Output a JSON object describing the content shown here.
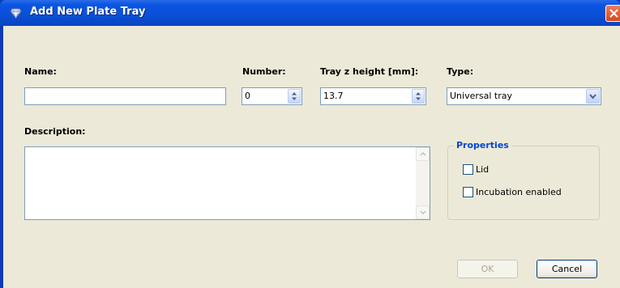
{
  "window": {
    "title": "Add New Plate Tray",
    "icons": {
      "app": "gem-icon",
      "close": "close-icon"
    },
    "colors": {
      "titlebar": "#0b55e3",
      "client": "#ece9d8",
      "close": "#d8461f",
      "group_title": "#0046d5"
    }
  },
  "form": {
    "name_label": "Name:",
    "name_value": "",
    "number_label": "Number:",
    "number_value": "0",
    "tray_z_label": "Tray z height [mm]:",
    "tray_z_value": "13.7",
    "type_label": "Type:",
    "type_value": "Universal tray",
    "description_label": "Description:",
    "description_value": ""
  },
  "properties": {
    "title": "Properties",
    "options": [
      {
        "label": "Lid",
        "checked": false
      },
      {
        "label": "Incubation enabled",
        "checked": false
      }
    ]
  },
  "buttons": {
    "ok": "OK",
    "ok_enabled": false,
    "cancel": "Cancel"
  }
}
